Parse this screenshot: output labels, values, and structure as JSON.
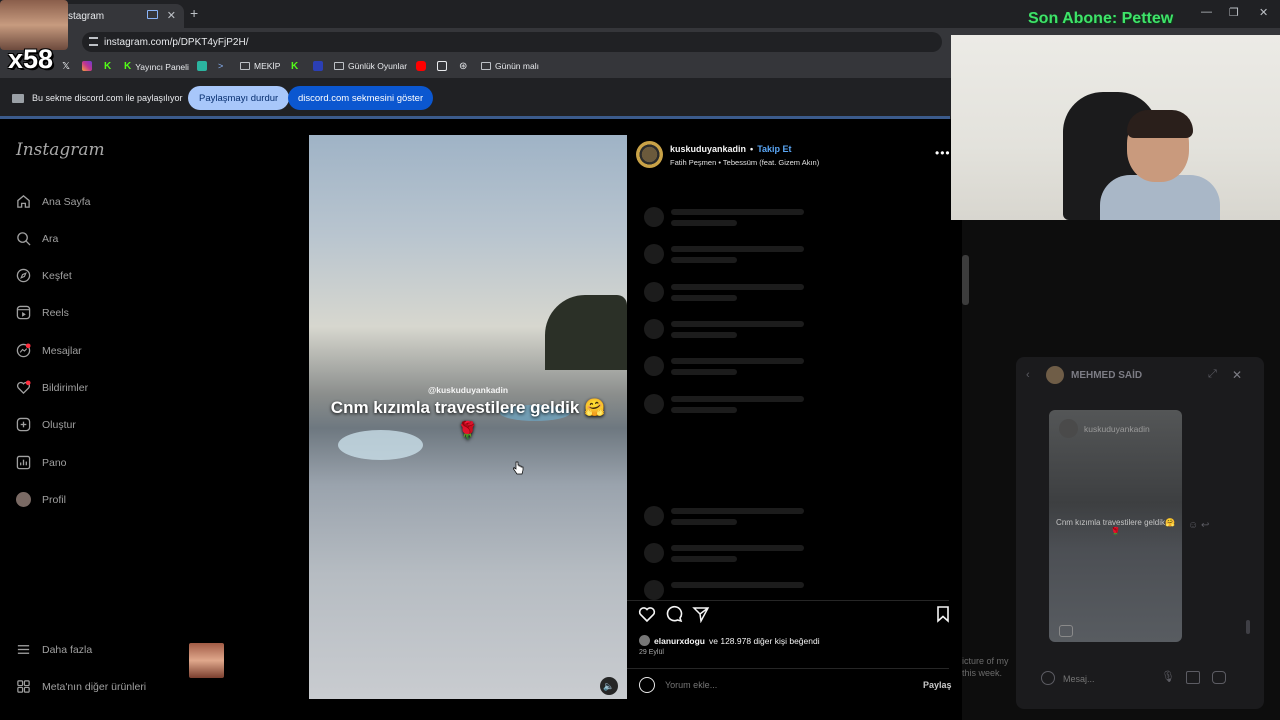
{
  "browser": {
    "tab_title": "stagram",
    "url": "instagram.com/p/DPKT4yFjP2H/",
    "bookmarks": [
      {
        "label": "Yayıncı Paneli"
      },
      {
        "label": "MEKİP"
      },
      {
        "label": "Günlük Oyunlar"
      },
      {
        "label": "Günün malı"
      }
    ],
    "share_notice": "Bu sekme discord.com ile paylaşılıyor",
    "stop_sharing": "Paylaşmayı durdur",
    "show_tab": "discord.com sekmesini göster"
  },
  "instagram": {
    "logo": "Instagram",
    "nav": [
      {
        "label": "Ana Sayfa",
        "icon": "home-icon"
      },
      {
        "label": "Ara",
        "icon": "search-icon"
      },
      {
        "label": "Keşfet",
        "icon": "compass-icon"
      },
      {
        "label": "Reels",
        "icon": "reels-icon"
      },
      {
        "label": "Mesajlar",
        "icon": "messenger-icon"
      },
      {
        "label": "Bildirimler",
        "icon": "heart-icon"
      },
      {
        "label": "Oluştur",
        "icon": "plus-icon"
      },
      {
        "label": "Pano",
        "icon": "dashboard-icon"
      },
      {
        "label": "Profil",
        "icon": "profile-avatar"
      }
    ],
    "more": "Daha fazla",
    "meta": "Meta'nın diğer ürünleri",
    "post": {
      "username": "kuskuduyankadin",
      "follow": "Takip Et",
      "song": "Fatih Peşmen • Tebessüm (feat. Gizem Akın)",
      "video_user": "@kuskuduyankadin",
      "video_caption": "Cnm kızımla travestilere geldik 🤗🌹",
      "likes_user": "elanurxdogu",
      "likes_rest": "ve 128.978 diğer kişi beğendi",
      "date": "29 Eylül",
      "comment_placeholder": "Yorum ekle...",
      "post_button": "Paylaş"
    },
    "behind_text": "icture of my\nthis week."
  },
  "discord_dm": {
    "title": "MEHMED SAİD",
    "card_user": "kuskuduyankadin",
    "card_caption": "Cnm kızımla travestilere geldik🤗🌹",
    "input_placeholder": "Mesaj..."
  },
  "stream": {
    "last_sub": "Son Abone: Pettew",
    "emote_count": "x58"
  }
}
